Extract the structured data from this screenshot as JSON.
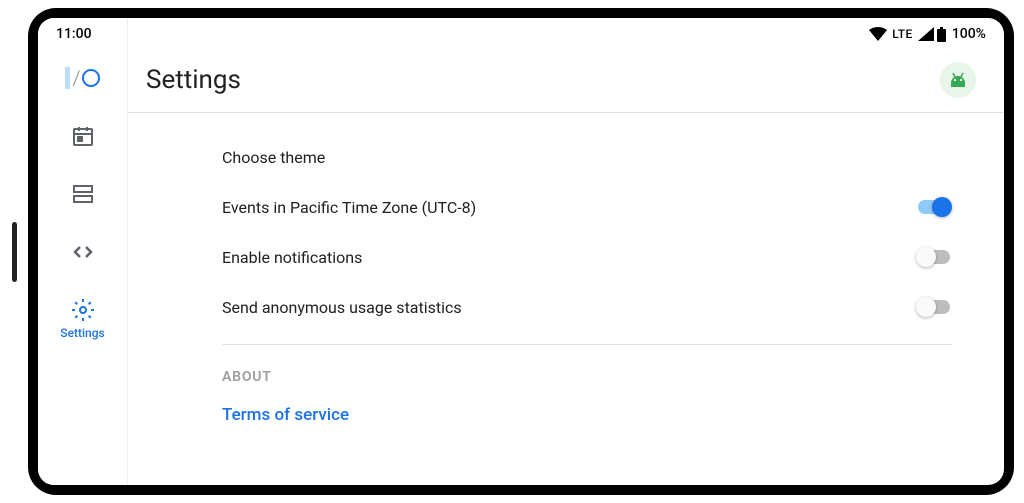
{
  "status": {
    "time": "11:00",
    "network": "LTE",
    "battery": "100%"
  },
  "sidebar": {
    "active_label": "Settings"
  },
  "header": {
    "title": "Settings"
  },
  "settings": {
    "theme_label": "Choose theme",
    "timezone_label": "Events in Pacific Time Zone (UTC-8)",
    "timezone_on": true,
    "notifications_label": "Enable notifications",
    "notifications_on": false,
    "stats_label": "Send anonymous usage statistics",
    "stats_on": false
  },
  "about": {
    "section_label": "ABOUT",
    "terms_label": "Terms of service"
  }
}
